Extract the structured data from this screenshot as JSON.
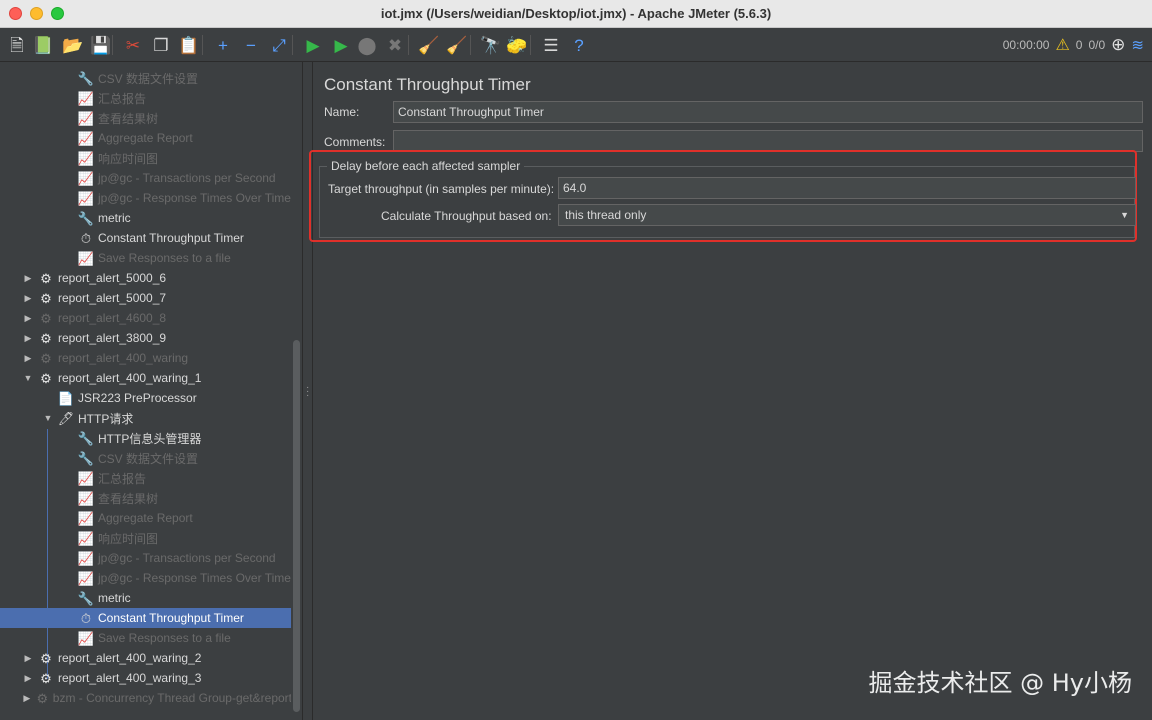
{
  "window": {
    "title": "iot.jmx (/Users/weidian/Desktop/iot.jmx) - Apache JMeter (5.6.3)"
  },
  "toolbar": {
    "timer": "00:00:00",
    "warning_count": "0",
    "threads": "0/0",
    "buttons": [
      {
        "name": "new-icon",
        "glyph": "🗎",
        "color": "#e8e8e8"
      },
      {
        "name": "templates-icon",
        "glyph": "📗",
        "color": "#7ab648"
      },
      {
        "name": "open-icon",
        "glyph": "📂",
        "color": "#e8a23a"
      },
      {
        "name": "save-icon",
        "glyph": "💾",
        "color": "#c8c8c8"
      },
      {
        "name": "cut-icon",
        "glyph": "✂",
        "color": "#d84a3a"
      },
      {
        "name": "copy-icon",
        "glyph": "❐",
        "color": "#d8d8d8"
      },
      {
        "name": "paste-icon",
        "glyph": "📋",
        "color": "#d8c07a"
      },
      {
        "name": "expand-icon",
        "glyph": "+",
        "color": "#5aa0ff"
      },
      {
        "name": "collapse-icon",
        "glyph": "−",
        "color": "#5aa0ff"
      },
      {
        "name": "toggle-icon",
        "glyph": "⤢",
        "color": "#5aa0ff"
      },
      {
        "name": "start-icon",
        "glyph": "▶",
        "color": "#36b84a"
      },
      {
        "name": "start-no-pauses-icon",
        "glyph": "▶",
        "color": "#36b84a"
      },
      {
        "name": "stop-icon",
        "glyph": "⬤",
        "color": "#777777"
      },
      {
        "name": "shutdown-icon",
        "glyph": "✖",
        "color": "#777777"
      },
      {
        "name": "clear-icon",
        "glyph": "🧹",
        "color": "#c8b078"
      },
      {
        "name": "clear-all-icon",
        "glyph": "🧹",
        "color": "#c8b078"
      },
      {
        "name": "search-icon",
        "glyph": "🔭",
        "color": "#d8d8d8"
      },
      {
        "name": "reset-search-icon",
        "glyph": "🧽",
        "color": "#e8c020"
      },
      {
        "name": "function-helper-icon",
        "glyph": "☰",
        "color": "#d8d8d8"
      },
      {
        "name": "help-icon",
        "glyph": "?",
        "color": "#5aa0ff"
      }
    ]
  },
  "tree": {
    "items": [
      {
        "label": "CSV 数据文件设置",
        "icon": "wrench-icon",
        "glyph": "🔧",
        "level": 3,
        "disabled": true,
        "arrow": ""
      },
      {
        "label": "汇总报告",
        "icon": "chart-icon",
        "glyph": "📈",
        "level": 3,
        "disabled": true,
        "arrow": ""
      },
      {
        "label": "查看结果树",
        "icon": "chart-icon",
        "glyph": "📈",
        "level": 3,
        "disabled": true,
        "arrow": ""
      },
      {
        "label": "Aggregate Report",
        "icon": "chart-icon",
        "glyph": "📈",
        "level": 3,
        "disabled": true,
        "arrow": ""
      },
      {
        "label": "响应时间图",
        "icon": "chart-icon",
        "glyph": "📈",
        "level": 3,
        "disabled": true,
        "arrow": ""
      },
      {
        "label": "jp@gc - Transactions per Second",
        "icon": "chart-icon",
        "glyph": "📈",
        "level": 3,
        "disabled": true,
        "arrow": ""
      },
      {
        "label": "jp@gc - Response Times Over Time",
        "icon": "chart-icon",
        "glyph": "📈",
        "level": 3,
        "disabled": true,
        "arrow": ""
      },
      {
        "label": "metric",
        "icon": "wrench-icon",
        "glyph": "🔧",
        "level": 3,
        "disabled": false,
        "arrow": ""
      },
      {
        "label": "Constant Throughput Timer",
        "icon": "timer-icon",
        "glyph": "⏱",
        "level": 3,
        "disabled": false,
        "arrow": ""
      },
      {
        "label": "Save Responses to a file",
        "icon": "chart-icon",
        "glyph": "📈",
        "level": 3,
        "disabled": true,
        "arrow": ""
      },
      {
        "label": "report_alert_5000_6",
        "icon": "gear-icon",
        "glyph": "⚙",
        "level": 1,
        "disabled": false,
        "arrow": "▶"
      },
      {
        "label": "report_alert_5000_7",
        "icon": "gear-icon",
        "glyph": "⚙",
        "level": 1,
        "disabled": false,
        "arrow": "▶"
      },
      {
        "label": "report_alert_4600_8",
        "icon": "gear-icon",
        "glyph": "⚙",
        "level": 1,
        "disabled": true,
        "arrow": "▶"
      },
      {
        "label": "report_alert_3800_9",
        "icon": "gear-icon",
        "glyph": "⚙",
        "level": 1,
        "disabled": false,
        "arrow": "▶"
      },
      {
        "label": "report_alert_400_waring",
        "icon": "gear-icon",
        "glyph": "⚙",
        "level": 1,
        "disabled": true,
        "arrow": "▶"
      },
      {
        "label": "report_alert_400_waring_1",
        "icon": "gear-icon",
        "glyph": "⚙",
        "level": 1,
        "disabled": false,
        "arrow": "▼"
      },
      {
        "label": "JSR223 PreProcessor",
        "icon": "script-icon",
        "glyph": "📄",
        "level": 2,
        "disabled": false,
        "arrow": ""
      },
      {
        "label": "HTTP请求",
        "icon": "pipette-icon",
        "glyph": "🖊",
        "level": 2,
        "disabled": false,
        "arrow": "▼"
      },
      {
        "label": "HTTP信息头管理器",
        "icon": "wrench-icon",
        "glyph": "🔧",
        "level": 3,
        "disabled": false,
        "arrow": ""
      },
      {
        "label": "CSV 数据文件设置",
        "icon": "wrench-icon",
        "glyph": "🔧",
        "level": 3,
        "disabled": true,
        "arrow": ""
      },
      {
        "label": "汇总报告",
        "icon": "chart-icon",
        "glyph": "📈",
        "level": 3,
        "disabled": true,
        "arrow": ""
      },
      {
        "label": "查看结果树",
        "icon": "chart-icon",
        "glyph": "📈",
        "level": 3,
        "disabled": true,
        "arrow": ""
      },
      {
        "label": "Aggregate Report",
        "icon": "chart-icon",
        "glyph": "📈",
        "level": 3,
        "disabled": true,
        "arrow": ""
      },
      {
        "label": "响应时间图",
        "icon": "chart-icon",
        "glyph": "📈",
        "level": 3,
        "disabled": true,
        "arrow": ""
      },
      {
        "label": "jp@gc - Transactions per Second",
        "icon": "chart-icon",
        "glyph": "📈",
        "level": 3,
        "disabled": true,
        "arrow": ""
      },
      {
        "label": "jp@gc - Response Times Over Time",
        "icon": "chart-icon",
        "glyph": "📈",
        "level": 3,
        "disabled": true,
        "arrow": ""
      },
      {
        "label": "metric",
        "icon": "wrench-icon",
        "glyph": "🔧",
        "level": 3,
        "disabled": false,
        "arrow": ""
      },
      {
        "label": "Constant Throughput Timer",
        "icon": "timer-icon",
        "glyph": "⏱",
        "level": 3,
        "disabled": false,
        "arrow": "",
        "selected": true
      },
      {
        "label": "Save Responses to a file",
        "icon": "chart-icon",
        "glyph": "📈",
        "level": 3,
        "disabled": true,
        "arrow": ""
      },
      {
        "label": "report_alert_400_waring_2",
        "icon": "gear-icon",
        "glyph": "⚙",
        "level": 1,
        "disabled": false,
        "arrow": "▶"
      },
      {
        "label": "report_alert_400_waring_3",
        "icon": "gear-icon",
        "glyph": "⚙",
        "level": 1,
        "disabled": false,
        "arrow": "▶"
      },
      {
        "label": "bzm - Concurrency Thread Group-get&report",
        "icon": "gear-icon",
        "glyph": "⚙",
        "level": 1,
        "disabled": true,
        "arrow": "▶"
      }
    ]
  },
  "main": {
    "panel_title": "Constant Throughput Timer",
    "name_label": "Name:",
    "name_value": "Constant Throughput Timer",
    "comments_label": "Comments:",
    "comments_value": "",
    "group_title": "Delay before each affected sampler",
    "target_label": "Target throughput (in samples per minute):",
    "target_value": "64.0",
    "calc_label": "Calculate Throughput based on:",
    "calc_value": "this thread only"
  },
  "watermark": "掘金技术社区 @ Hy小杨",
  "colors": {
    "highlight_border": "#e0302a",
    "selection": "#4b6eaf"
  }
}
